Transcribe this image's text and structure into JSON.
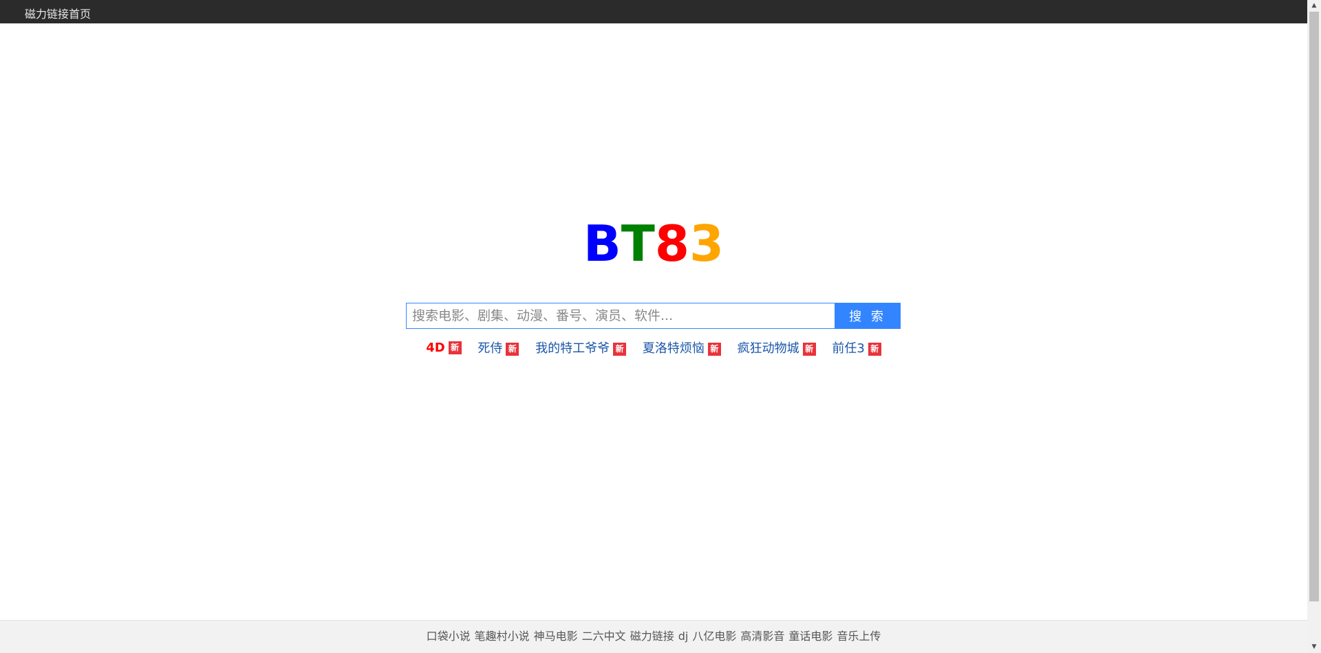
{
  "topbar": {
    "home_link": "磁力链接首页"
  },
  "logo": {
    "letters": [
      {
        "char": "B",
        "color": "#0000ff"
      },
      {
        "char": "T",
        "color": "#008000"
      },
      {
        "char": "8",
        "color": "#ff0000"
      },
      {
        "char": "3",
        "color": "#ffa500"
      }
    ]
  },
  "search": {
    "placeholder": "搜索电影、剧集、动漫、番号、演员、软件...",
    "value": "",
    "button_label": "搜 索",
    "accent_color": "#3385ff"
  },
  "hot_searches": [
    {
      "label": "4D",
      "badge": "新"
    },
    {
      "label": "死侍",
      "badge": "新"
    },
    {
      "label": "我的特工爷爷",
      "badge": "新"
    },
    {
      "label": "夏洛特烦恼",
      "badge": "新"
    },
    {
      "label": "疯狂动物城",
      "badge": "新"
    },
    {
      "label": "前任3",
      "badge": "新"
    }
  ],
  "footer": {
    "links": [
      "口袋小说",
      "笔趣村小说",
      "神马电影",
      "二六中文",
      "磁力链接",
      "dj",
      "八亿电影",
      "高清影音",
      "童话电影",
      "音乐上传"
    ]
  }
}
